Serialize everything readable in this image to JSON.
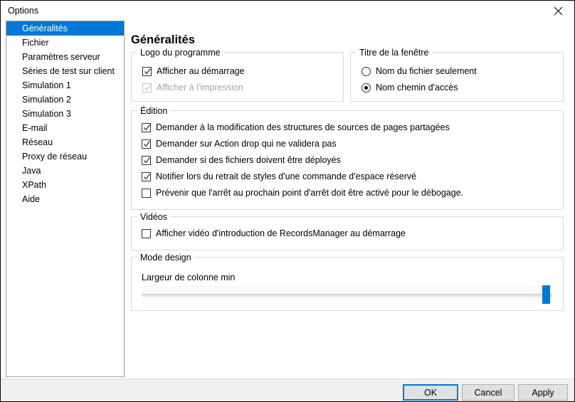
{
  "window": {
    "title": "Options",
    "close_icon": "close-icon"
  },
  "sidebar": {
    "items": [
      {
        "label": "Généralités",
        "selected": true
      },
      {
        "label": "Fichier",
        "selected": false
      },
      {
        "label": "Paramètres serveur",
        "selected": false
      },
      {
        "label": "Séries de test sur client",
        "selected": false
      },
      {
        "label": "Simulation 1",
        "selected": false
      },
      {
        "label": "Simulation 2",
        "selected": false
      },
      {
        "label": "Simulation 3",
        "selected": false
      },
      {
        "label": "E-mail",
        "selected": false
      },
      {
        "label": "Réseau",
        "selected": false
      },
      {
        "label": "Proxy de réseau",
        "selected": false
      },
      {
        "label": "Java",
        "selected": false
      },
      {
        "label": "XPath",
        "selected": false
      },
      {
        "label": "Aide",
        "selected": false
      }
    ]
  },
  "main": {
    "page_title": "Généralités",
    "groups": {
      "logo": {
        "legend": "Logo du programme",
        "options": [
          {
            "label": "Afficher au démarrage",
            "checked": true,
            "disabled": false
          },
          {
            "label": "Afficher à l'impression",
            "checked": true,
            "disabled": true
          }
        ]
      },
      "window_title": {
        "legend": "Titre de la fenêtre",
        "options": [
          {
            "label": "Nom du fichier seulement",
            "selected": false
          },
          {
            "label": "Nom chemin d'accès",
            "selected": true
          }
        ]
      },
      "edition": {
        "legend": "Édition",
        "options": [
          {
            "label": "Demander à la modification des structures de sources de pages partagées",
            "checked": true
          },
          {
            "label": "Demander sur Action drop qui ne validera pas",
            "checked": true
          },
          {
            "label": "Demander si des fichiers doivent être déployés",
            "checked": true
          },
          {
            "label": "Notifier lors du retrait de styles d'une commande d'espace réservé",
            "checked": true
          },
          {
            "label": "Prévenir que l'arrêt au prochain point d'arrêt doit être activé pour le débogage.",
            "checked": false
          }
        ]
      },
      "videos": {
        "legend": "Vidéos",
        "options": [
          {
            "label": "Afficher vidéo d'introduction de RecordsManager au démarrage",
            "checked": false
          }
        ]
      },
      "design_mode": {
        "legend": "Mode design",
        "slider_label": "Largeur de colonne min",
        "slider_value": 100,
        "slider_min": 0,
        "slider_max": 100
      }
    }
  },
  "footer": {
    "buttons": [
      {
        "label": "OK",
        "default": true
      },
      {
        "label": "Cancel",
        "default": false
      },
      {
        "label": "Apply",
        "default": false
      }
    ]
  },
  "colors": {
    "accent": "#0078d7",
    "selection": "#0078d7",
    "group_border": "#d9d9d9",
    "footer_bg": "#f0f0f0"
  }
}
